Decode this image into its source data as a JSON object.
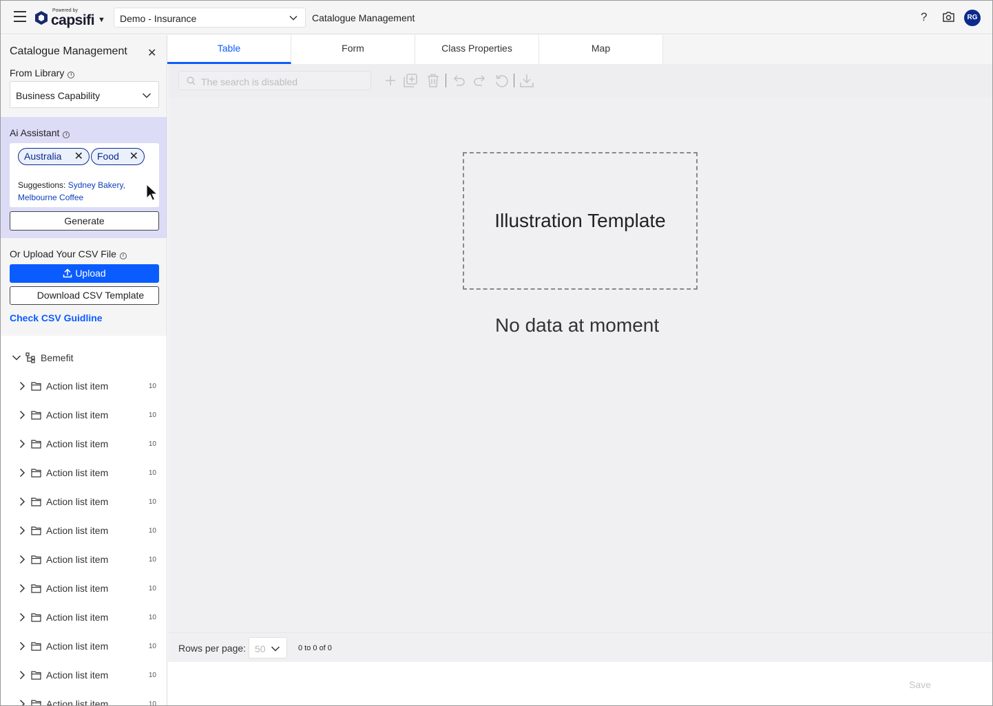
{
  "header": {
    "logo_powered": "Powered by",
    "logo_word": "capsifi",
    "environment": "Demo - Insurance",
    "app_title": "Catalogue Management",
    "help_icon": "?",
    "avatar_initials": "RG"
  },
  "sidebar": {
    "title": "Catalogue Management",
    "from_library_label": "From Library",
    "library_value": "Business Capability",
    "ai_assistant_label": "Ai Assistant",
    "chips": [
      "Australia",
      "Food"
    ],
    "suggestions_label": "Suggestions:",
    "suggestion_1": "Sydney Bakery,",
    "suggestion_2": "Melbourne Coffee",
    "generate_label": "Generate",
    "upload_section_label": "Or Upload Your CSV File",
    "upload_label": "Upload",
    "download_template_label": "Download CSV Template",
    "guideline_link": "Check CSV Guidline",
    "tree_root": "Bemefit",
    "tree_items": [
      {
        "label": "Action list item",
        "count": "10"
      },
      {
        "label": "Action list item",
        "count": "10"
      },
      {
        "label": "Action list item",
        "count": "10"
      },
      {
        "label": "Action list item",
        "count": "10"
      },
      {
        "label": "Action list item",
        "count": "10"
      },
      {
        "label": "Action list item",
        "count": "10"
      },
      {
        "label": "Action list item",
        "count": "10"
      },
      {
        "label": "Action list item",
        "count": "10"
      },
      {
        "label": "Action list item",
        "count": "10"
      },
      {
        "label": "Action list item",
        "count": "10"
      },
      {
        "label": "Action list item",
        "count": "10"
      },
      {
        "label": "Action list item",
        "count": "10"
      }
    ]
  },
  "tabs": [
    {
      "label": "Table",
      "active": true
    },
    {
      "label": "Form",
      "active": false
    },
    {
      "label": "Class Properties",
      "active": false
    },
    {
      "label": "Map",
      "active": false
    }
  ],
  "main": {
    "search_placeholder": "The search is disabled",
    "illustration_label": "Illustration Template",
    "empty_message": "No data at moment",
    "rows_per_page_label": "Rows per page:",
    "rows_per_page_value": "50",
    "range_text": "0 to 0 of 0",
    "save_label": "Save"
  },
  "colors": {
    "accent": "#0b5cff",
    "brand_navy": "#0b2a8c",
    "ai_panel": "#dcdcf7"
  }
}
